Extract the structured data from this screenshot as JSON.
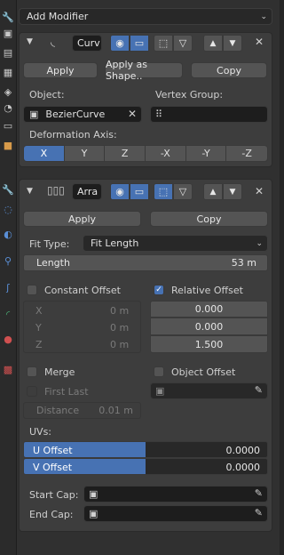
{
  "add_modifier": "Add Modifier",
  "curve_mod": {
    "name": "Curv",
    "apply": "Apply",
    "apply_as_shape": "Apply as Shape..",
    "copy": "Copy",
    "object_label": "Object:",
    "object_value": "BezierCurve",
    "vertex_group_label": "Vertex Group:",
    "deformation_axis_label": "Deformation Axis:",
    "axes": [
      "X",
      "Y",
      "Z",
      "-X",
      "-Y",
      "-Z"
    ],
    "active_axis": "X"
  },
  "array_mod": {
    "name": "Arra",
    "apply": "Apply",
    "copy": "Copy",
    "fit_type_label": "Fit Type:",
    "fit_type_value": "Fit Length",
    "length_label": "Length",
    "length_value": "53 m",
    "constant_offset": "Constant Offset",
    "relative_offset": "Relative Offset",
    "constant_offset_checked": false,
    "relative_offset_checked": true,
    "const_x_label": "X",
    "const_y_label": "Y",
    "const_z_label": "Z",
    "const_x": "0 m",
    "const_y": "0 m",
    "const_z": "0 m",
    "rel_x": "0.000",
    "rel_y": "0.000",
    "rel_z": "1.500",
    "merge": "Merge",
    "object_offset": "Object Offset",
    "first_last": "First Last",
    "distance_label": "Distance",
    "distance_value": "0.01 m",
    "uvs_label": "UVs:",
    "u_offset_label": "U Offset",
    "u_offset_value": "0.0000",
    "v_offset_label": "V Offset",
    "v_offset_value": "0.0000",
    "start_cap": "Start Cap:",
    "end_cap": "End Cap:"
  },
  "colors": {
    "accent": "#4772b3",
    "panel": "#303030",
    "modifier_bg": "#3d3d3d",
    "button": "#545454",
    "field": "#1d1d1d"
  }
}
